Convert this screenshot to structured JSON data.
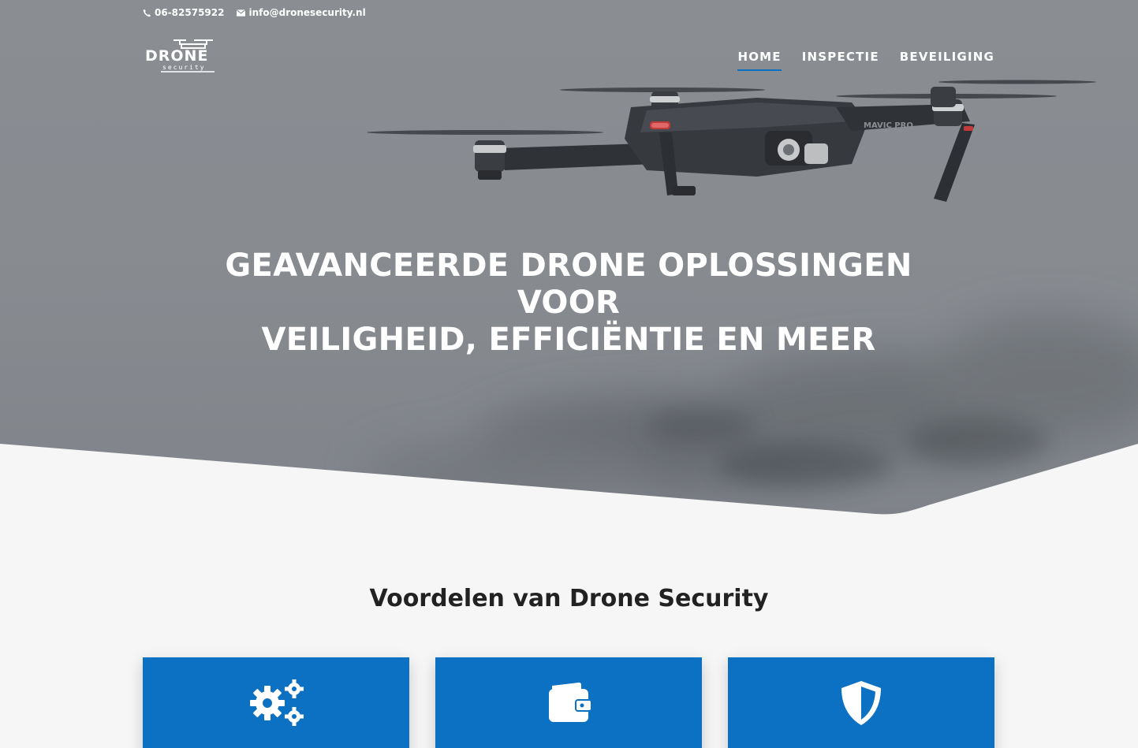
{
  "topbar": {
    "phone": "06-82575922",
    "email": "info@dronesecurity.nl"
  },
  "logo": {
    "name": "logo-drone-security",
    "text_main": "DRONE",
    "text_sub": "security"
  },
  "nav": {
    "items": [
      {
        "label": "HOME",
        "active": true
      },
      {
        "label": "INSPECTIE",
        "active": false
      },
      {
        "label": "BEVEILIGING",
        "active": false
      }
    ]
  },
  "hero": {
    "headline_line1": "GEAVANCEERDE DRONE OPLOSSINGEN VOOR",
    "headline_line2": "VEILIGHEID, EFFICIËNTIE EN MEER",
    "drone_model_label": "MAVIC PRO"
  },
  "benefits": {
    "title": "Voordelen van Drone Security",
    "cards": [
      {
        "icon": "gears-icon"
      },
      {
        "icon": "wallet-icon"
      },
      {
        "icon": "shield-icon"
      }
    ]
  },
  "colors": {
    "accent": "#0c71c3",
    "hero_bg": "#8a8e93",
    "page_bg": "#f6f6f6",
    "title_text": "#222222"
  }
}
